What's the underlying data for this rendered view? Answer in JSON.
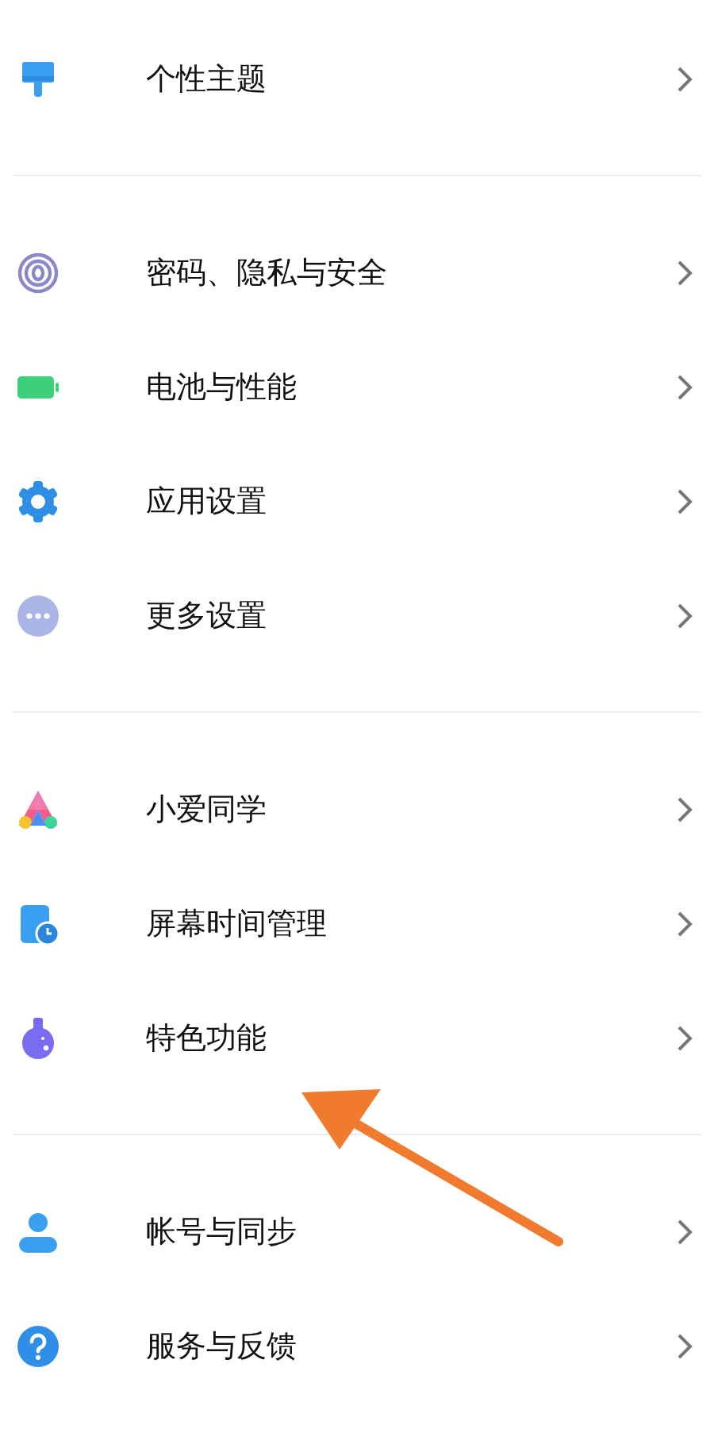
{
  "groups": [
    {
      "items": [
        {
          "label": "个性主题"
        }
      ]
    },
    {
      "items": [
        {
          "label": "密码、隐私与安全"
        },
        {
          "label": "电池与性能"
        },
        {
          "label": "应用设置"
        },
        {
          "label": "更多设置"
        }
      ]
    },
    {
      "items": [
        {
          "label": "小爱同学"
        },
        {
          "label": "屏幕时间管理"
        },
        {
          "label": "特色功能"
        }
      ]
    },
    {
      "items": [
        {
          "label": "帐号与同步"
        },
        {
          "label": "服务与反馈"
        }
      ]
    }
  ]
}
